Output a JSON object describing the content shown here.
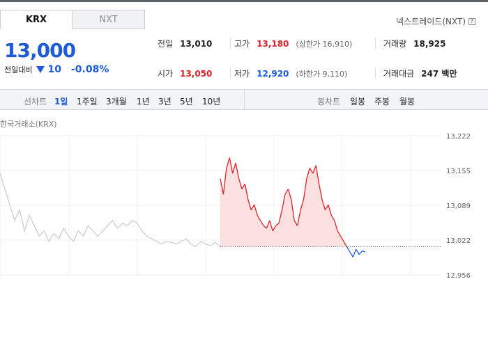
{
  "tabs": [
    {
      "label": "KRX",
      "active": true
    },
    {
      "label": "NXT",
      "active": false
    }
  ],
  "nxt_link": {
    "label": "넥스트레이드(NXT)",
    "help_icon": "?"
  },
  "current": {
    "price": "13,000",
    "change_label": "전일대비",
    "change_direction": "down",
    "change_value": "10",
    "change_pct": "-0.08%"
  },
  "quote": {
    "prev": {
      "label": "전일",
      "value": "13,010"
    },
    "open": {
      "label": "시가",
      "value": "13,050"
    },
    "high": {
      "label": "고가",
      "value": "13,180",
      "sub": "(상한가 16,910)"
    },
    "low": {
      "label": "저가",
      "value": "12,920",
      "sub": "(하한가 9,110)"
    },
    "volume": {
      "label": "거래량",
      "value": "18,925"
    },
    "amount": {
      "label": "거래대금",
      "value": "247 백만"
    }
  },
  "controls": {
    "line_title": "선차트",
    "periods": [
      "1일",
      "1주일",
      "3개월",
      "1년",
      "3년",
      "5년",
      "10년"
    ],
    "selected_period": "1일",
    "candle_title": "봉차트",
    "candle_periods": [
      "일봉",
      "주봉",
      "월봉"
    ]
  },
  "exchange_label": "한국거래소(KRX)",
  "colors": {
    "up": "#d9232a",
    "down": "#1e5bd8",
    "prev_line": "#c8cbd0",
    "fill_up": "#fbe0e0"
  },
  "chart_data": {
    "type": "line",
    "ylim": [
      12956,
      13222
    ],
    "y_ticks": [
      "13,222",
      "13,155",
      "13,089",
      "13,022",
      "12,956"
    ],
    "prev_close": 13010,
    "prev_day_series": [
      13150,
      13120,
      13090,
      13060,
      13080,
      13040,
      13070,
      13050,
      13030,
      13040,
      13020,
      13035,
      13025,
      13045,
      13030,
      13020,
      13040,
      13030,
      13050,
      13040,
      13030,
      13040,
      13050,
      13060,
      13045,
      13055,
      13050,
      13060,
      13055,
      13040,
      13030,
      13025,
      13020,
      13015,
      13020,
      13018,
      13015,
      13020,
      13025,
      13015,
      13010,
      13020,
      13015,
      13012,
      13018,
      13010
    ],
    "today_series": [
      13140,
      13110,
      13160,
      13180,
      13150,
      13170,
      13140,
      13120,
      13130,
      13100,
      13080,
      13090,
      13070,
      13060,
      13050,
      13045,
      13060,
      13040,
      13050,
      13055,
      13080,
      13110,
      13120,
      13100,
      13060,
      13050,
      13080,
      13100,
      13140,
      13160,
      13150,
      13165,
      13130,
      13100,
      13080,
      13090,
      13070,
      13060,
      13040,
      13030,
      13020,
      13010,
      13000,
      12990,
      13005,
      12995,
      13002,
      13000
    ]
  }
}
